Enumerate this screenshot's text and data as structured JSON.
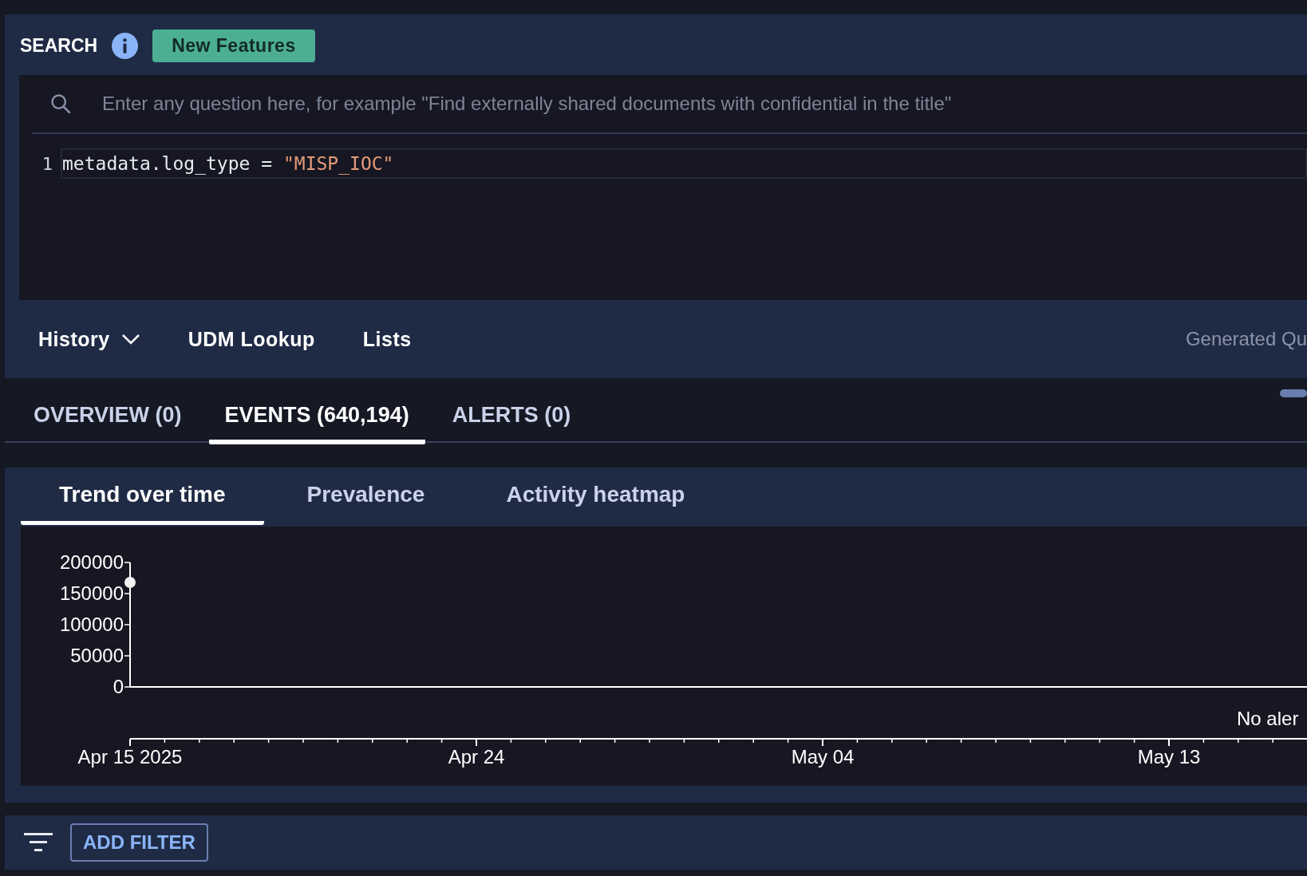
{
  "header": {
    "title": "SEARCH",
    "badge": "New Features"
  },
  "search": {
    "placeholder": "Enter any question here, for example \"Find externally shared documents with confidential in the title\""
  },
  "editor": {
    "lines": [
      {
        "number": "1",
        "tokens": [
          {
            "kind": "plain",
            "text": "metadata.log_type = "
          },
          {
            "kind": "string",
            "text": "\"MISP_IOC\""
          }
        ]
      }
    ]
  },
  "toolbar": {
    "items": [
      {
        "label": "History",
        "kind": "dropdown"
      },
      {
        "label": "UDM Lookup",
        "kind": "link"
      },
      {
        "label": "Lists",
        "kind": "link"
      }
    ],
    "generated": "Generated Qu"
  },
  "tabs": [
    {
      "label": "OVERVIEW (0)",
      "selected": false
    },
    {
      "label": "EVENTS (640,194)",
      "selected": true
    },
    {
      "label": "ALERTS (0)",
      "selected": false
    }
  ],
  "view_tabs": [
    {
      "label": "Trend over time",
      "selected": true
    },
    {
      "label": "Prevalence",
      "selected": false
    },
    {
      "label": "Activity heatmap",
      "selected": false
    }
  ],
  "chart_data": {
    "type": "scatter",
    "categories": [
      "Apr 15 2025",
      "Apr 24",
      "May 04",
      "May 13"
    ],
    "series": [
      {
        "values": [
          168000,
          null,
          null,
          null
        ]
      }
    ],
    "ylim": [
      0,
      200000
    ],
    "yticks": [
      0,
      50000,
      100000,
      150000,
      200000
    ],
    "annotations": [
      {
        "text": "No aler"
      }
    ]
  },
  "filter_bar": {
    "button": "ADD FILTER"
  }
}
